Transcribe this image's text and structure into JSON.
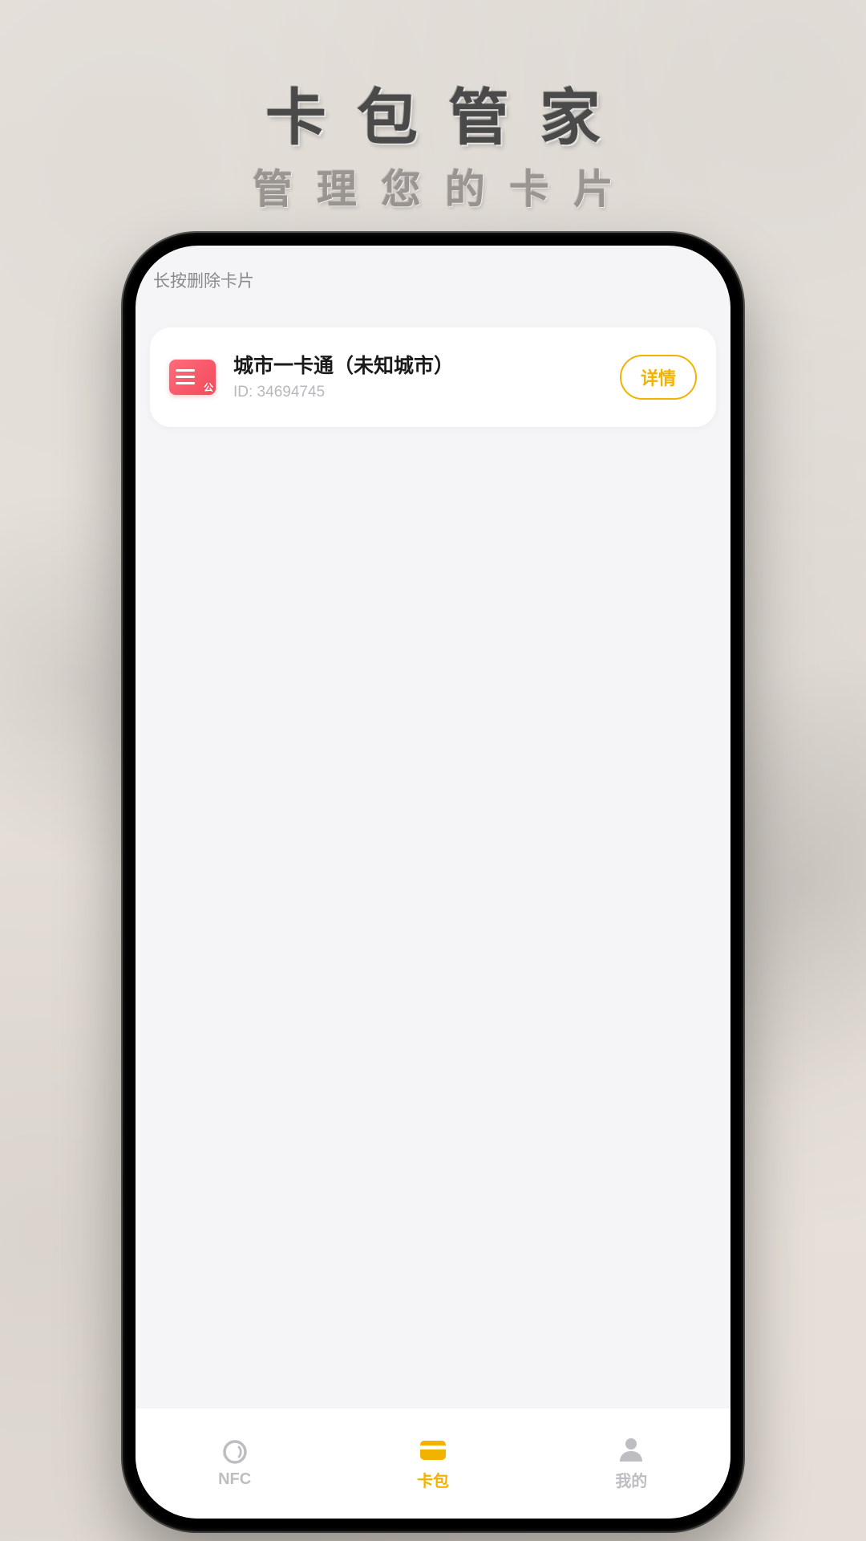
{
  "hero": {
    "title": "卡包管家",
    "subtitle": "管理您的卡片"
  },
  "hint": "长按删除卡片",
  "card": {
    "title": "城市一卡通（未知城市）",
    "id_label": "ID: 34694745",
    "detail_label": "详情"
  },
  "tabs": {
    "nfc": "NFC",
    "wallet": "卡包",
    "mine": "我的"
  },
  "colors": {
    "accent": "#f2b200",
    "card_icon": "#f14b5c"
  }
}
